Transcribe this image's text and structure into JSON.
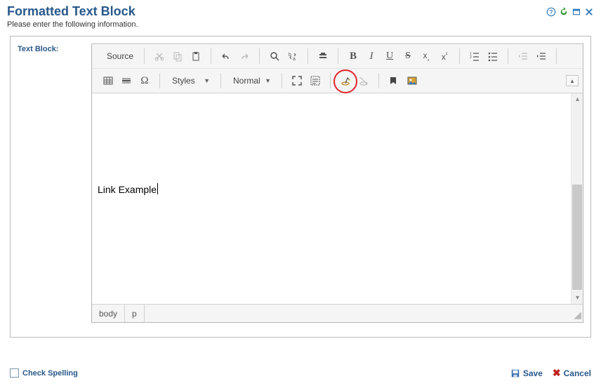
{
  "header": {
    "title": "Formatted Text Block",
    "subtitle": "Please enter the following information."
  },
  "field": {
    "label": "Text Block:"
  },
  "toolbar": {
    "source": "Source",
    "styles": "Styles",
    "format": "Normal"
  },
  "content": {
    "text": "Link Example"
  },
  "status": {
    "path1": "body",
    "path2": "p"
  },
  "footer": {
    "check_spelling": "Check Spelling",
    "save": "Save",
    "cancel": "Cancel"
  }
}
